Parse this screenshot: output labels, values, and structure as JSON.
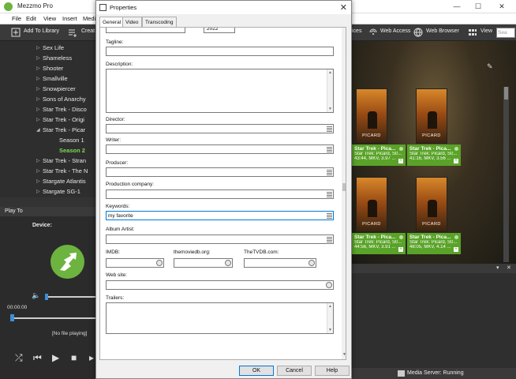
{
  "app": {
    "title": "Mezzmo Pro",
    "menu": [
      "File",
      "Edit",
      "View",
      "Insert",
      "Medi"
    ],
    "toolbar": {
      "add_to_library": "Add To Library",
      "create": "Creat",
      "devices": "ices",
      "web_access": "Web Access",
      "web_browser": "Web Browser",
      "view": "View",
      "search_placeholder": "Sea"
    }
  },
  "tree": {
    "items": [
      {
        "label": "Sex Life",
        "arrow": "▷"
      },
      {
        "label": "Shameless",
        "arrow": "▷"
      },
      {
        "label": "Shooter",
        "arrow": "▷"
      },
      {
        "label": "Smallville",
        "arrow": "▷"
      },
      {
        "label": "Snowpiercer",
        "arrow": "▷"
      },
      {
        "label": "Sons of Anarchy",
        "arrow": "▷"
      },
      {
        "label": "Star Trek - Disco",
        "arrow": "▷"
      },
      {
        "label": "Star Trek - Origi",
        "arrow": "▷"
      },
      {
        "label": "Star Trek - Picar",
        "arrow": "◢"
      },
      {
        "label": "Season 1"
      },
      {
        "label": "Season 2"
      },
      {
        "label": "Star Trek - Stran",
        "arrow": "▷"
      },
      {
        "label": "Star Trek - The N",
        "arrow": "▷"
      },
      {
        "label": "Stargate Atlantis",
        "arrow": "▷"
      },
      {
        "label": "Stargate SG-1",
        "arrow": "▷"
      }
    ]
  },
  "playto": {
    "header": "Play To",
    "device_label": "Device:",
    "time": "00:00:00",
    "status": "[No file playing]"
  },
  "posters": [
    {
      "title": "Star Trek - Pica...",
      "line2": "Star Trek: Picard, S0...",
      "line3": "43:44, MKV, 3.97 ...",
      "poster_text": "PICARD"
    },
    {
      "title": "Star Trek - Pica...",
      "line2": "Star Trek: Picard, S0...",
      "line3": "41:16, MKV, 3.56 ...",
      "poster_text": "PICARD"
    },
    {
      "title": "Star Trek - Pica...",
      "line2": "Star Trek: Picard, S0...",
      "line3": "44:56, MKV, 3.91 ...",
      "poster_text": "PICARD"
    },
    {
      "title": "Star Trek - Pica...",
      "line2": "Star Trek: Picard, S0...",
      "line3": "48:05, MKV, 4.14 ...",
      "poster_text": "PICARD"
    }
  ],
  "status_bar": {
    "text": "Media Server: Running"
  },
  "dialog": {
    "title": "Properties",
    "tabs": [
      "General",
      "Video",
      "Transcoding"
    ],
    "year_value": "2022",
    "labels": {
      "tagline": "Tagline:",
      "description": "Description:",
      "director": "Director:",
      "writer": "Writer:",
      "producer": "Producer:",
      "production_company": "Production company:",
      "keywords": "Keywords:",
      "album_artist": "Album Artist:",
      "imdb": "IMDB:",
      "themoviedb": "themoviedb.org:",
      "thetvdb": "TheTVDB.com:",
      "website": "Web site:",
      "trailers": "Trailers:"
    },
    "values": {
      "keywords": "my favorite"
    },
    "buttons": {
      "ok": "OK",
      "cancel": "Cancel",
      "help": "Help"
    }
  }
}
